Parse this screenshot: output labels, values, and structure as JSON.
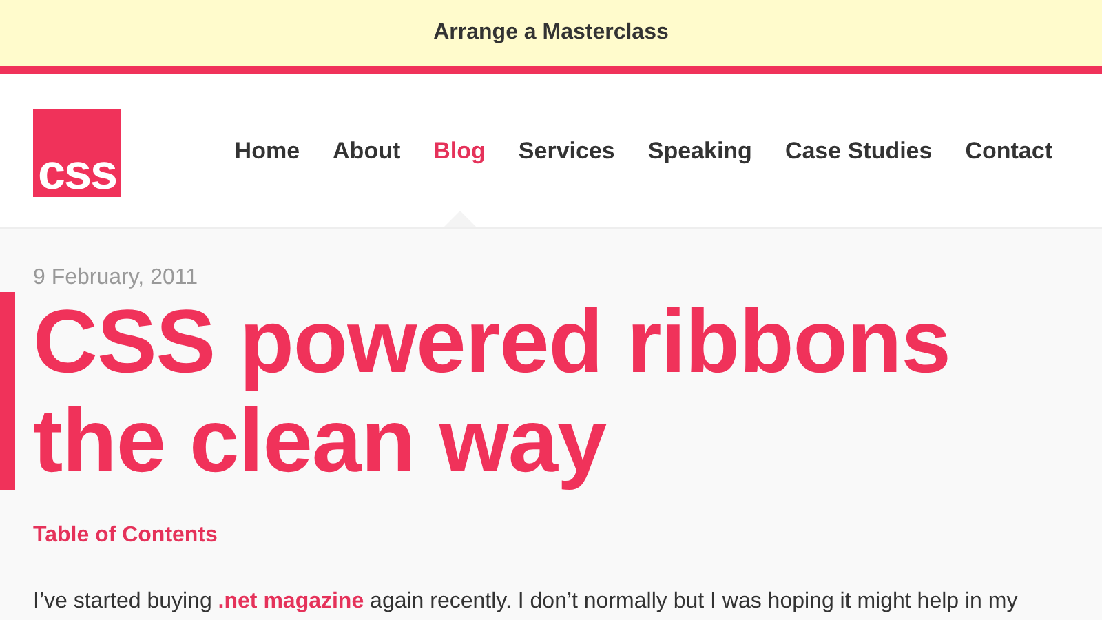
{
  "banner": {
    "text": "Arrange a Masterclass"
  },
  "logo": {
    "text": "css"
  },
  "nav": [
    {
      "label": "Home",
      "selected": false
    },
    {
      "label": "About",
      "selected": false
    },
    {
      "label": "Blog",
      "selected": true
    },
    {
      "label": "Services",
      "selected": false
    },
    {
      "label": "Speaking",
      "selected": false
    },
    {
      "label": "Case Studies",
      "selected": false
    },
    {
      "label": "Contact",
      "selected": false
    }
  ],
  "article": {
    "date": "9 February, 2011",
    "title": "CSS powered ribbons the clean way",
    "toc_link": "Table of Contents",
    "paragraph": "I’ve started buying **.net magazine** again recently. I don’t normally but I was hoping it might help in my"
  }
}
